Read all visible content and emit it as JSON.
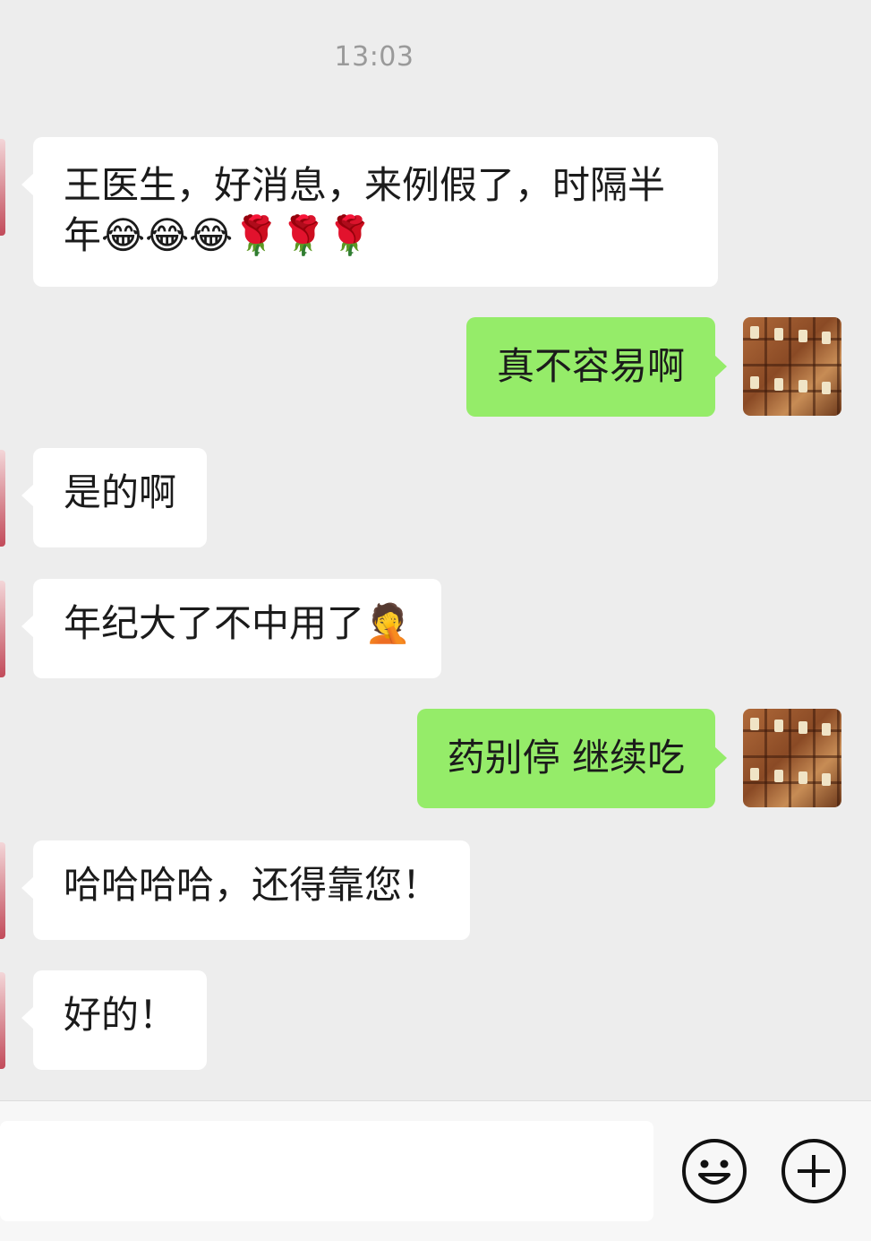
{
  "time": "13:03",
  "messages": [
    {
      "side": "left",
      "text": "王医生，好消息，来例假了，时隔半年😂😂😂🌹🌹🌹"
    },
    {
      "side": "right",
      "text": "真不容易啊"
    },
    {
      "side": "left",
      "text": "是的啊"
    },
    {
      "side": "left",
      "text": "年纪大了不中用了🤦"
    },
    {
      "side": "right",
      "text": "药别停 继续吃"
    },
    {
      "side": "left",
      "text": "哈哈哈哈，还得靠您！"
    },
    {
      "side": "left",
      "text": "好的！"
    }
  ],
  "input": {
    "value": ""
  },
  "icons": {
    "emoji": "smiley-face-icon",
    "more": "plus-circle-icon"
  }
}
